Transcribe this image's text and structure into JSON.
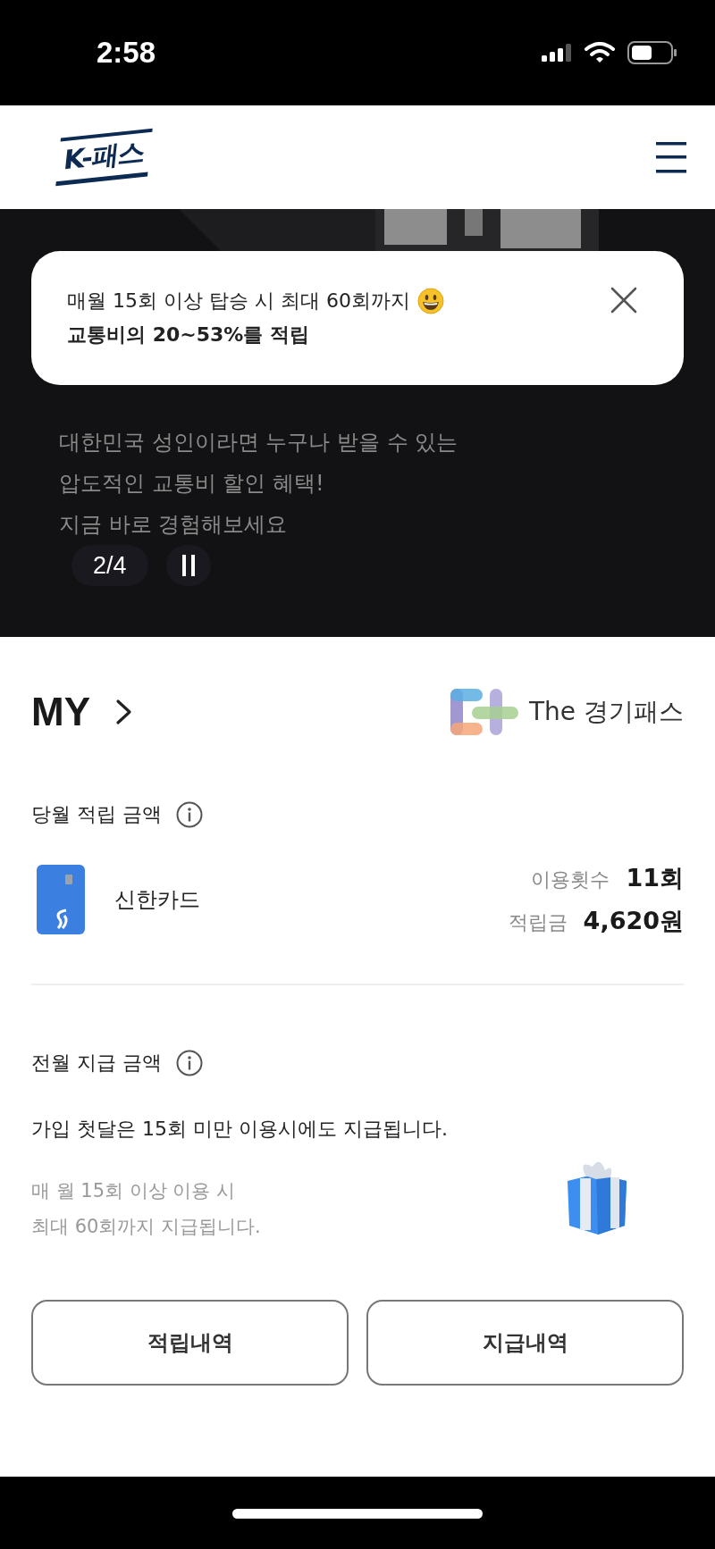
{
  "status_bar": {
    "time": "2:58"
  },
  "header": {
    "logo": "K-패스"
  },
  "hero": {
    "caption": [
      "대한민국 성인이라면 누구나 받을 수 있는",
      "압도적인 교통비 할인 혜택!",
      "지금 바로 경험해보세요"
    ],
    "counter": "2/4",
    "playing": true
  },
  "toast": {
    "line": "매월 15회 이상 탑승 시 최대 60회까지",
    "highlight": "교통비의 20~53%를 적립"
  },
  "my": {
    "title": "MY",
    "brand": "The 경기패스"
  },
  "accrual": {
    "title": "당월 적립 금액",
    "card": {
      "name": "신한카드"
    },
    "stats": [
      {
        "label": "이용횟수",
        "value": "11회"
      },
      {
        "label": "적립금",
        "value": "4,620원"
      }
    ]
  },
  "payout": {
    "title": "전월 지급 금액",
    "note": "가입 첫달은 15회 미만 이용시에도 지급됩니다.",
    "sub": [
      "매 월 15회 이상 이용 시",
      "최대 60회까지 지급됩니다."
    ]
  },
  "buttons": [
    "적립내역",
    "지급내역"
  ]
}
